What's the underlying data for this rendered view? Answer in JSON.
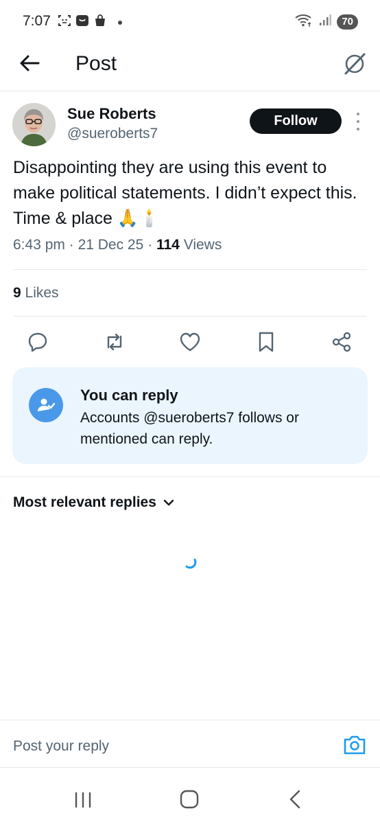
{
  "status_bar": {
    "time": "7:07",
    "battery": "70",
    "icons": [
      "face-scan-icon",
      "notification-app-icon",
      "shopping-bag-icon",
      "dot-icon",
      "wifi-icon",
      "signal-icon"
    ]
  },
  "header": {
    "title": "Post",
    "back_icon": "arrow-left-icon",
    "grok_icon": "grok-icon"
  },
  "post": {
    "author_name": "Sue Roberts",
    "author_handle": "@sueroberts7",
    "follow_label": "Follow",
    "text": "Disappointing they are using this event to make political statements. I didn’t expect this. Time & place 🙏🕯️",
    "time": "6:43 pm",
    "date": "21 Dec 25",
    "views_count": "114",
    "views_label": "Views",
    "likes_count": "9",
    "likes_label": "Likes"
  },
  "actions": [
    "reply-icon",
    "repost-icon",
    "like-icon",
    "bookmark-icon",
    "share-icon"
  ],
  "reply_notice": {
    "title": "You can reply",
    "description": "Accounts @sueroberts7 follows or mentioned can reply."
  },
  "replies": {
    "sort_label": "Most relevant replies"
  },
  "composer": {
    "placeholder": "Post your reply"
  },
  "colors": {
    "accent": "#1d9bf0",
    "text": "#0f1419",
    "secondary_text": "#536471",
    "card_bg": "#eaf5fd",
    "follow_bg": "#0f1419"
  }
}
